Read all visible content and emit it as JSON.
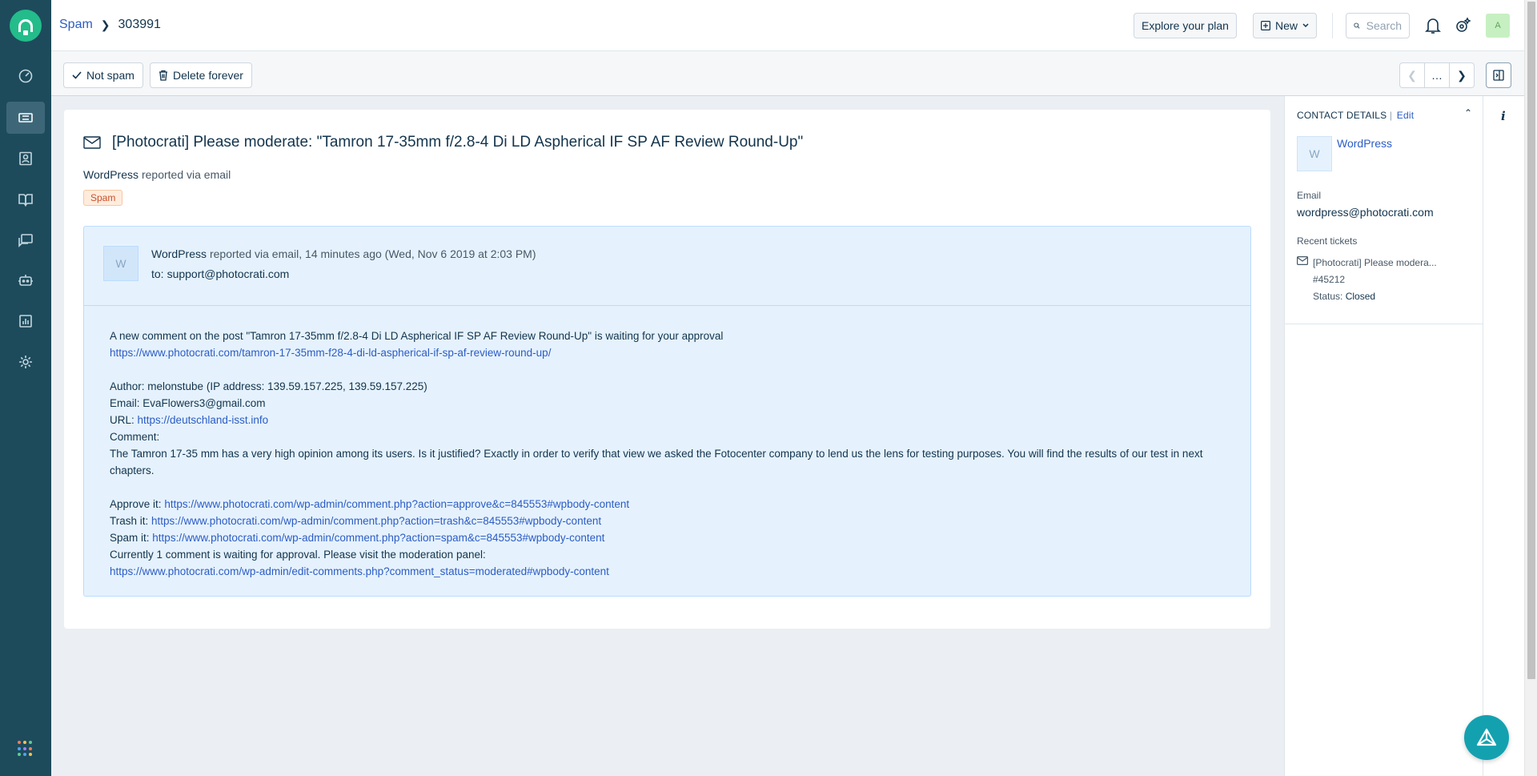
{
  "breadcrumb": {
    "parent": "Spam",
    "current": "303991"
  },
  "header": {
    "explore_label": "Explore your plan",
    "new_label": "New",
    "search_placeholder": "Search",
    "avatar_initial": "A"
  },
  "toolbar": {
    "not_spam_label": "Not spam",
    "delete_forever_label": "Delete forever",
    "more_label": "…"
  },
  "ticket": {
    "subject": "[Photocrati] Please moderate: \"Tamron 17-35mm f/2.8-4 Di LD Aspherical IF SP AF Review Round-Up\"",
    "requester": "WordPress",
    "reported_via": "reported via email",
    "status_badge": "Spam"
  },
  "message": {
    "avatar_initial": "W",
    "sender": "WordPress",
    "meta": "reported via email, 14 minutes ago (Wed, Nov 6 2019 at 2:03 PM)",
    "to_label": "to:",
    "to_address": "support@photocrati.com",
    "body": {
      "intro": "A new comment on the post \"Tamron 17-35mm f/2.8-4 Di LD Aspherical IF SP AF Review Round-Up\" is waiting for your approval",
      "post_url": "https://www.photocrati.com/tamron-17-35mm-f28-4-di-ld-aspherical-if-sp-af-review-round-up/",
      "author": "Author: melonstube (IP address: 139.59.157.225, 139.59.157.225)",
      "email": "Email: EvaFlowers3@gmail.com",
      "url_label": "URL:",
      "url_value": "https://deutschland-isst.info",
      "comment_label": "Comment:",
      "comment_text": "The Tamron 17-35 mm has a very high opinion among its users. Is it justified? Exactly in order to verify that view we asked the Fotocenter company to lend us the lens for testing purposes. You will find the results of our test in next chapters.",
      "approve_label": "Approve it:",
      "approve_url": "https://www.photocrati.com/wp-admin/comment.php?action=approve&c=845553#wpbody-content",
      "trash_label": "Trash it:",
      "trash_url": "https://www.photocrati.com/wp-admin/comment.php?action=trash&c=845553#wpbody-content",
      "spam_label": "Spam it:",
      "spam_url": "https://www.photocrati.com/wp-admin/comment.php?action=spam&c=845553#wpbody-content",
      "waiting_text": "Currently 1 comment is waiting for approval. Please visit the moderation panel:",
      "moderation_url": "https://www.photocrati.com/wp-admin/edit-comments.php?comment_status=moderated#wpbody-content"
    }
  },
  "contact": {
    "title": "CONTACT DETAILS",
    "edit_label": "Edit",
    "avatar_initial": "W",
    "name": "WordPress",
    "email_label": "Email",
    "email": "wordpress@photocrati.com",
    "recent_label": "Recent tickets",
    "recent": {
      "subject": "[Photocrati] Please modera...",
      "id": "#45212",
      "status_label": "Status:",
      "status": "Closed"
    }
  },
  "info_label": "i",
  "colors": {
    "sidebar": "#1d4b5c",
    "brand_green": "#24bc8a",
    "link": "#2c5cc5",
    "email_bg": "#e5f2fd",
    "fab": "#13a1b0"
  },
  "icons": {
    "sidebar": [
      "dashboard-icon",
      "tickets-icon",
      "contacts-icon",
      "solutions-icon",
      "forums-icon",
      "bot-icon",
      "reports-icon",
      "admin-icon"
    ]
  }
}
